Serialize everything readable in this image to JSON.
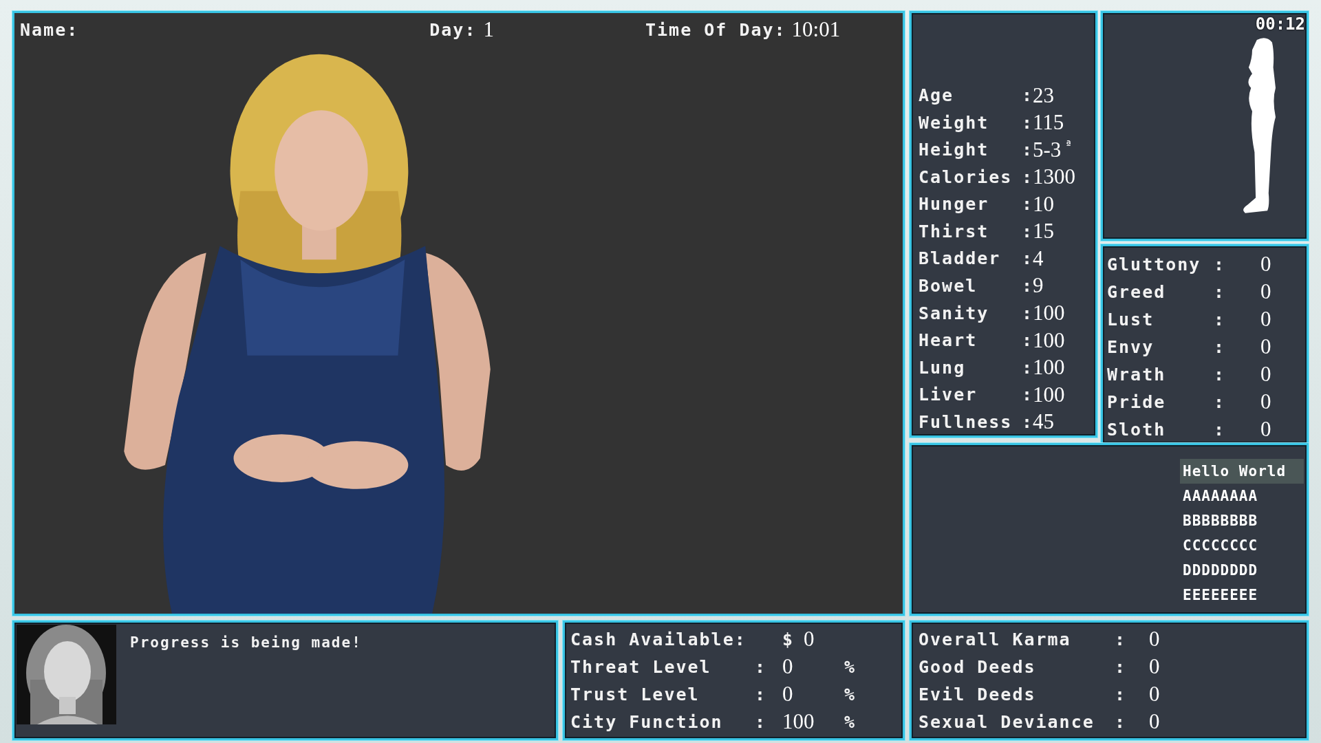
{
  "header": {
    "name_label": "Name:",
    "day_label": "Day:",
    "day": "1",
    "time_label": "Time Of Day:",
    "time": "10:01"
  },
  "clock": "00:12",
  "stats": [
    {
      "label": "Age",
      "sep": ":",
      "value": "23"
    },
    {
      "label": "Weight",
      "sep": ":",
      "value": "115"
    },
    {
      "label": "Height",
      "sep": ":",
      "value": "5-3",
      "unit": "ª"
    },
    {
      "label": "Calories",
      "sep": ":",
      "value": "1300"
    },
    {
      "label": "Hunger",
      "sep": ":",
      "value": "10"
    },
    {
      "label": "Thirst",
      "sep": ":",
      "value": "15"
    },
    {
      "label": "Bladder",
      "sep": ":",
      "value": "4"
    },
    {
      "label": "Bowel",
      "sep": ":",
      "value": "9"
    },
    {
      "label": "Sanity",
      "sep": ":",
      "value": "100"
    },
    {
      "label": "Heart",
      "sep": ":",
      "value": "100"
    },
    {
      "label": "Lung",
      "sep": ":",
      "value": "100"
    },
    {
      "label": "Liver",
      "sep": ":",
      "value": "100"
    },
    {
      "label": "Fullness",
      "sep": ":",
      "value": "45"
    }
  ],
  "sins": [
    {
      "label": "Gluttony",
      "sep": ":",
      "value": "0"
    },
    {
      "label": "Greed",
      "sep": ":",
      "value": "0"
    },
    {
      "label": "Lust",
      "sep": ":",
      "value": "0"
    },
    {
      "label": "Envy",
      "sep": ":",
      "value": "0"
    },
    {
      "label": "Wrath",
      "sep": ":",
      "value": "0"
    },
    {
      "label": "Pride",
      "sep": ":",
      "value": "0"
    },
    {
      "label": "Sloth",
      "sep": ":",
      "value": "0"
    }
  ],
  "list": [
    {
      "label": "Hello World",
      "selected": true
    },
    {
      "label": "AAAAAAAA",
      "selected": false
    },
    {
      "label": "BBBBBBBB",
      "selected": false
    },
    {
      "label": "CCCCCCCC",
      "selected": false
    },
    {
      "label": "DDDDDDDD",
      "selected": false
    },
    {
      "label": "EEEEEEEE",
      "selected": false
    }
  ],
  "message": "Progress is being made!",
  "city": [
    {
      "label": "Cash Available:",
      "prefix": "$",
      "value": "0"
    },
    {
      "label": "Threat Level",
      "sep": ":",
      "value": "0",
      "unit": "%"
    },
    {
      "label": "Trust Level",
      "sep": ":",
      "value": "0",
      "unit": "%"
    },
    {
      "label": "City Function",
      "sep": ":",
      "value": "100",
      "unit": "%"
    }
  ],
  "karma": [
    {
      "label": "Overall Karma",
      "sep": ":",
      "value": "0"
    },
    {
      "label": "Good Deeds",
      "sep": ":",
      "value": "0"
    },
    {
      "label": "Evil Deeds",
      "sep": ":",
      "value": "0"
    },
    {
      "label": "Sexual Deviance",
      "sep": ":",
      "value": "0"
    }
  ]
}
